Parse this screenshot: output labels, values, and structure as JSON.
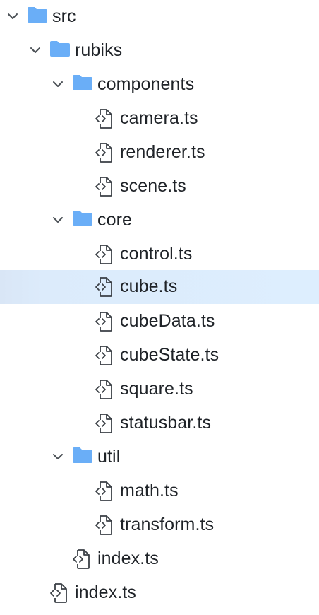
{
  "file_tree": {
    "icons": {
      "folder_color": "#6aaef7",
      "chevron_color": "#4a4f55",
      "file_icon_color": "#3a3f45",
      "selected_background": "#ddeefe"
    },
    "items": [
      {
        "label": "src",
        "kind": "folder",
        "expanded": true,
        "depth": 0
      },
      {
        "label": "rubiks",
        "kind": "folder",
        "expanded": true,
        "depth": 1
      },
      {
        "label": "components",
        "kind": "folder",
        "expanded": true,
        "depth": 2
      },
      {
        "label": "camera.ts",
        "kind": "file",
        "depth": 3
      },
      {
        "label": "renderer.ts",
        "kind": "file",
        "depth": 3
      },
      {
        "label": "scene.ts",
        "kind": "file",
        "depth": 3
      },
      {
        "label": "core",
        "kind": "folder",
        "expanded": true,
        "depth": 2
      },
      {
        "label": "control.ts",
        "kind": "file",
        "depth": 3
      },
      {
        "label": "cube.ts",
        "kind": "file",
        "depth": 3,
        "selected": true
      },
      {
        "label": "cubeData.ts",
        "kind": "file",
        "depth": 3
      },
      {
        "label": "cubeState.ts",
        "kind": "file",
        "depth": 3
      },
      {
        "label": "square.ts",
        "kind": "file",
        "depth": 3
      },
      {
        "label": "statusbar.ts",
        "kind": "file",
        "depth": 3
      },
      {
        "label": "util",
        "kind": "folder",
        "expanded": true,
        "depth": 2
      },
      {
        "label": "math.ts",
        "kind": "file",
        "depth": 3
      },
      {
        "label": "transform.ts",
        "kind": "file",
        "depth": 3
      },
      {
        "label": "index.ts",
        "kind": "file",
        "depth": 2
      },
      {
        "label": "index.ts",
        "kind": "file",
        "depth": 1
      }
    ]
  }
}
